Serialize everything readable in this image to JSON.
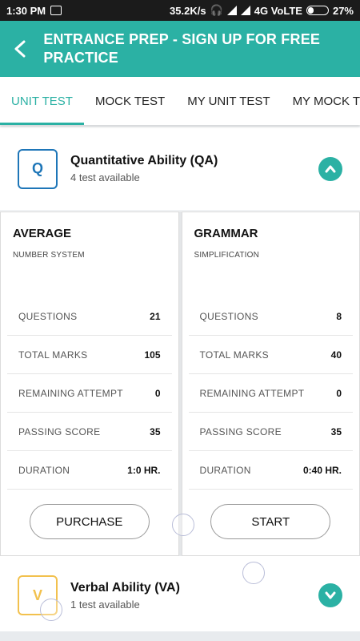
{
  "status_bar": {
    "time": "1:30 PM",
    "speed": "35.2K/s",
    "network": "4G VoLTE",
    "battery": "27%"
  },
  "app_bar": {
    "title": "ENTRANCE PREP  - SIGN UP FOR FREE PRACTICE"
  },
  "tabs": [
    {
      "label": "UNIT TEST",
      "active": true
    },
    {
      "label": "MOCK TEST",
      "active": false
    },
    {
      "label": "MY UNIT TEST",
      "active": false
    },
    {
      "label": "MY MOCK TEST",
      "active": false
    }
  ],
  "subjects": [
    {
      "badge": "Q",
      "name": "Quantitative Ability (QA)",
      "available": "4 test available",
      "expanded": true,
      "cards": [
        {
          "title": "AVERAGE",
          "subtitle": "NUMBER SYSTEM",
          "stats": [
            {
              "label": "QUESTIONS",
              "value": "21"
            },
            {
              "label": "TOTAL MARKS",
              "value": "105"
            },
            {
              "label": "REMAINING ATTEMPT",
              "value": "0"
            },
            {
              "label": "PASSING SCORE",
              "value": "35"
            },
            {
              "label": "DURATION",
              "value": "1:0 HR."
            }
          ],
          "button": "PURCHASE"
        },
        {
          "title": "GRAMMAR",
          "subtitle": "SIMPLIFICATION",
          "stats": [
            {
              "label": "QUESTIONS",
              "value": "8"
            },
            {
              "label": "TOTAL MARKS",
              "value": "40"
            },
            {
              "label": "REMAINING ATTEMPT",
              "value": "0"
            },
            {
              "label": "PASSING SCORE",
              "value": "35"
            },
            {
              "label": "DURATION",
              "value": "0:40 HR."
            }
          ],
          "button": "START"
        }
      ]
    },
    {
      "badge": "V",
      "name": "Verbal Ability (VA)",
      "available": "1 test available",
      "expanded": false
    }
  ],
  "colors": {
    "accent": "#2bb1a4",
    "qa_badge": "#1e76b8",
    "va_badge": "#f2c14e"
  }
}
